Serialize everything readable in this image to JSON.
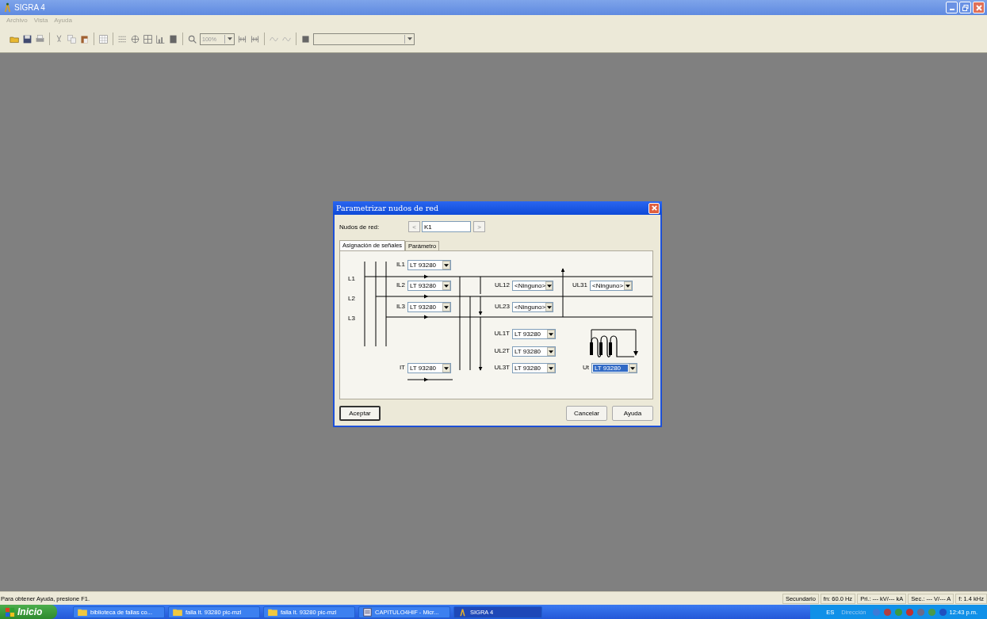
{
  "window": {
    "title": "SIGRA 4"
  },
  "menu": [
    {
      "label": "Archivo",
      "disabled": true
    },
    {
      "label": "Vista",
      "disabled": true
    },
    {
      "label": "Ayuda",
      "disabled": true
    }
  ],
  "toolbar": {
    "zoom": {
      "value": "100%",
      "disabled": true
    }
  },
  "dialog": {
    "title": "Parametrizar nudos de red",
    "node_label": "Nudos de red:",
    "prev": "<",
    "node_value": "K1",
    "next": ">",
    "tabs": [
      {
        "label": "Asignación de señales",
        "selected": true
      },
      {
        "label": "Parámetro",
        "selected": false
      }
    ],
    "lines": [
      "L1",
      "L2",
      "L3"
    ],
    "signals": [
      {
        "label": "IL1",
        "value": "LT 93280",
        "highlighted": false
      },
      {
        "label": "IL2",
        "value": "LT 93280",
        "highlighted": false
      },
      {
        "label": "IL3",
        "value": "LT 93280",
        "highlighted": false
      },
      {
        "label": "UL12",
        "value": "<Ninguno>",
        "highlighted": false
      },
      {
        "label": "UL31",
        "value": "<Ninguno>",
        "highlighted": false
      },
      {
        "label": "UL23",
        "value": "<Ninguno>",
        "highlighted": false
      },
      {
        "label": "UL1T",
        "value": "LT 93280",
        "highlighted": false
      },
      {
        "label": "UL2T",
        "value": "LT 93280",
        "highlighted": false
      },
      {
        "label": "IT",
        "value": "LT 93280",
        "highlighted": false
      },
      {
        "label": "UL3T",
        "value": "LT 93280",
        "highlighted": false
      },
      {
        "label": "Ut",
        "value": "LT 93280",
        "highlighted": true
      }
    ],
    "buttons": [
      {
        "label": "Aceptar",
        "default": true
      },
      {
        "label": "Cancelar",
        "default": false
      },
      {
        "label": "Ayuda",
        "default": false
      }
    ]
  },
  "status_bar": {
    "hint": "Para obtener Ayuda, presione F1.",
    "panes": [
      "Secundario",
      "fn: 60.0 Hz",
      "Pri.: --- kV/--- kA",
      "Sec.: --- V/--- A",
      "f: 1.4 kHz"
    ]
  },
  "taskbar": {
    "start": "Inicio",
    "tasks": [
      {
        "label": "biblioteca de fallas co...",
        "kind": "folder",
        "selected": false
      },
      {
        "label": "falla lt. 93280 pic-mzl",
        "kind": "folder",
        "selected": false
      },
      {
        "label": "falla lt. 93280 pic-mzl",
        "kind": "folder",
        "selected": false
      },
      {
        "label": "CAPITULO4HIF - Micr...",
        "kind": "document",
        "selected": false
      },
      {
        "label": "SIGRA 4",
        "kind": "app",
        "selected": true
      }
    ],
    "language": "ES",
    "address": "Dirección",
    "clock": "12:43 p.m."
  }
}
